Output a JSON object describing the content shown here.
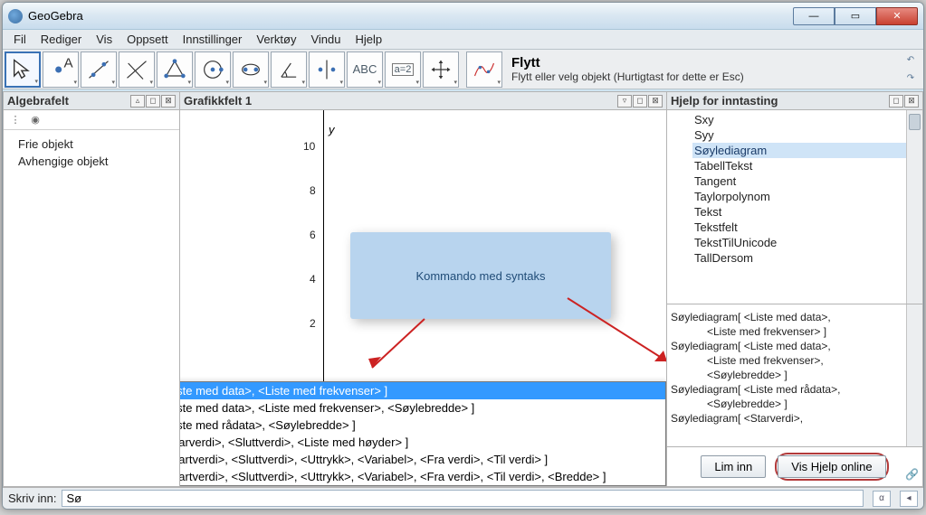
{
  "window": {
    "title": "GeoGebra"
  },
  "menu": {
    "fil": "Fil",
    "rediger": "Rediger",
    "vis": "Vis",
    "oppsett": "Oppsett",
    "innstillinger": "Innstillinger",
    "verktoy": "Verktøy",
    "vindu": "Vindu",
    "hjelp": "Hjelp"
  },
  "toolbar": {
    "abc": "ABC",
    "a2": "a=2",
    "tool_title": "Flytt",
    "tool_sub": "Flytt eller velg objekt (Hurtigtast for dette er Esc)"
  },
  "algebra": {
    "title": "Algebrafelt",
    "items": [
      "Frie objekt",
      "Avhengige objekt"
    ]
  },
  "graph": {
    "title": "Grafikkfelt 1",
    "axis_y": "y",
    "ticks": [
      "10",
      "8",
      "6",
      "4",
      "2"
    ]
  },
  "callout": {
    "text": "Kommando med syntaks"
  },
  "suggest": {
    "rows": [
      "Søylediagram[ <Liste med data>, <Liste med frekvenser> ]",
      "Søylediagram[ <Liste med data>, <Liste med frekvenser>, <Søylebredde> ]",
      "Søylediagram[ <Liste med rådata>, <Søylebredde> ]",
      "Søylediagram[ <Starverdi>, <Sluttverdi>, <Liste med høyder> ]",
      "Søylediagram[ <Startverdi>, <Sluttverdi>, <Uttrykk>, <Variabel>, <Fra verdi>, <Til verdi> ]",
      "Søylediagram[ <Startverdi>, <Sluttverdi>, <Uttrykk>, <Variabel>, <Fra verdi>, <Til verdi>, <Bredde> ]"
    ]
  },
  "help": {
    "title": "Hjelp for inntasting",
    "items": [
      "Sxy",
      "Syy",
      "Søylediagram",
      "TabellTekst",
      "Tangent",
      "Taylorpolynom",
      "Tekst",
      "Tekstfelt",
      "TekstTilUnicode",
      "TallDersom"
    ],
    "syntax": [
      "Søylediagram[ <Liste med data>,",
      "<Liste med frekvenser> ]",
      "Søylediagram[ <Liste med data>,",
      "<Liste med frekvenser>,",
      "<Søylebredde> ]",
      "Søylediagram[ <Liste med rådata>,",
      "<Søylebredde> ]",
      "Søylediagram[ <Starverdi>,"
    ],
    "paste_btn": "Lim inn",
    "online_btn": "Vis Hjelp online"
  },
  "input": {
    "label": "Skriv inn:",
    "value": "Sø"
  }
}
